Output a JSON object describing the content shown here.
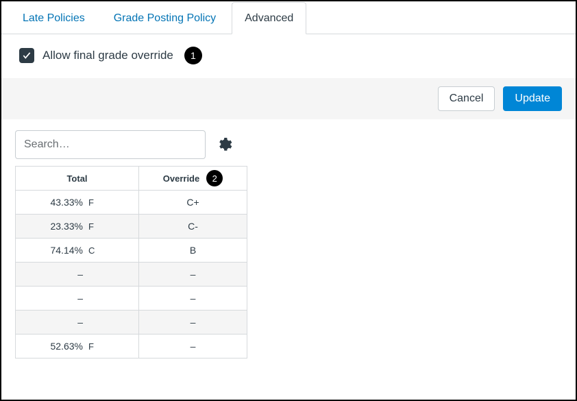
{
  "tabs": {
    "items": [
      {
        "label": "Late Policies",
        "active": false
      },
      {
        "label": "Grade Posting Policy",
        "active": false
      },
      {
        "label": "Advanced",
        "active": true
      }
    ]
  },
  "advanced": {
    "allow_override_label": "Allow final grade override",
    "allow_override_checked": true,
    "callout_1": "1"
  },
  "footer": {
    "cancel_label": "Cancel",
    "update_label": "Update"
  },
  "search": {
    "placeholder": "Search…",
    "value": ""
  },
  "table": {
    "col_total": "Total",
    "col_override": "Override",
    "callout_2": "2",
    "rows": [
      {
        "pct": "43.33%",
        "letter": "F",
        "override": "C+"
      },
      {
        "pct": "23.33%",
        "letter": "F",
        "override": "C-"
      },
      {
        "pct": "74.14%",
        "letter": "C",
        "override": "B"
      },
      {
        "pct": "–",
        "letter": "",
        "override": "–"
      },
      {
        "pct": "–",
        "letter": "",
        "override": "–"
      },
      {
        "pct": "–",
        "letter": "",
        "override": "–"
      },
      {
        "pct": "52.63%",
        "letter": "F",
        "override": "–"
      }
    ]
  }
}
